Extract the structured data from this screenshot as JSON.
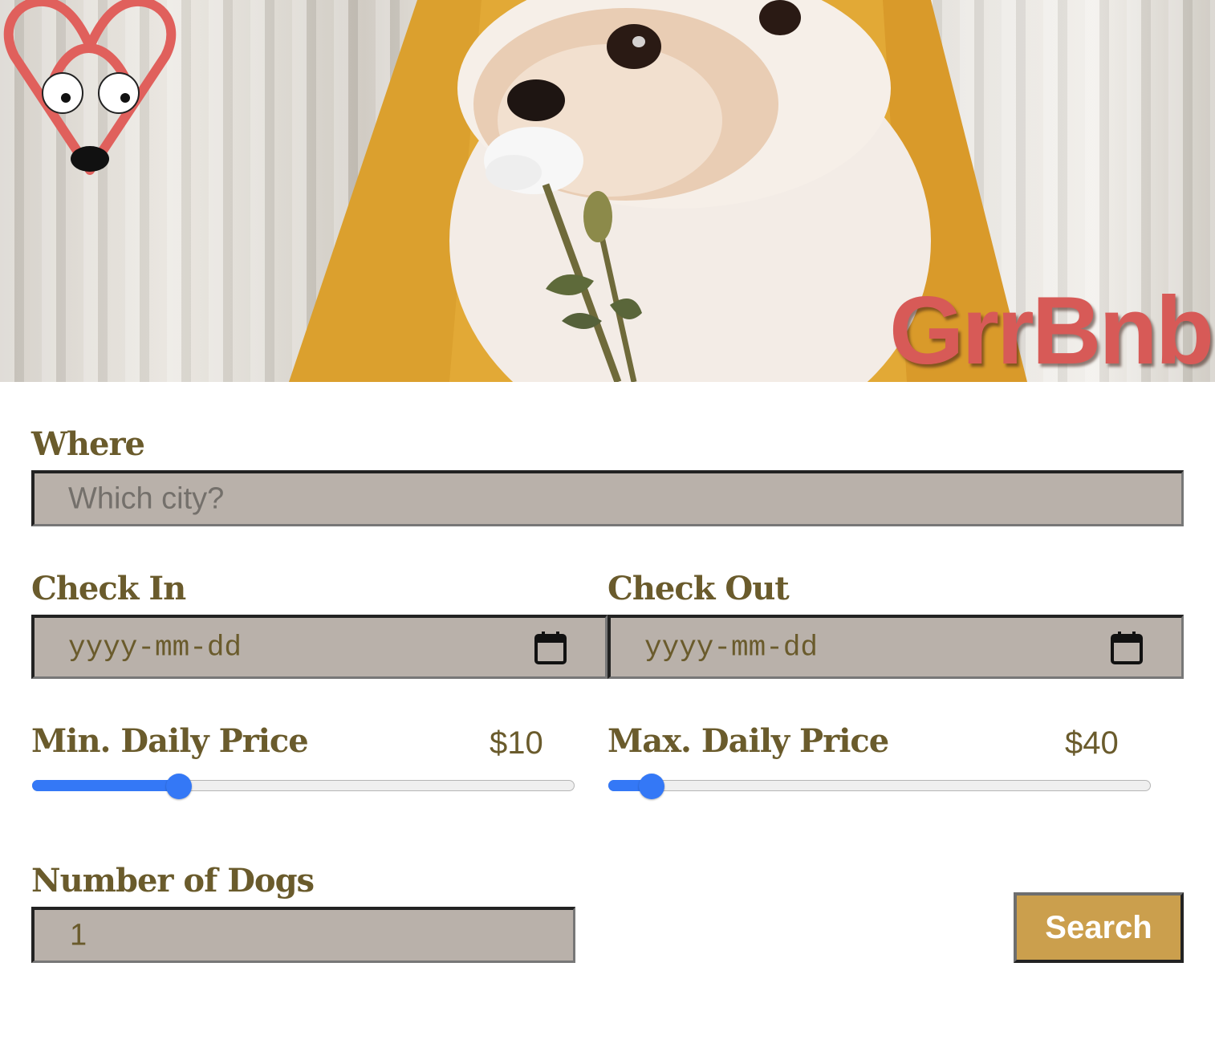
{
  "brand": {
    "name": "GrrBnb",
    "logo_icon": "dog-heart-logo-icon",
    "accent_color": "#d75a57"
  },
  "hero": {
    "image": "pomeranian-with-rose-photo"
  },
  "form": {
    "where": {
      "label": "Where",
      "placeholder": "Which city?",
      "value": ""
    },
    "check_in": {
      "label": "Check In",
      "placeholder": "yyyy-mm-dd",
      "icon": "calendar-icon"
    },
    "check_out": {
      "label": "Check Out",
      "placeholder": "yyyy-mm-dd",
      "icon": "calendar-icon"
    },
    "min_price": {
      "label": "Min. Daily Price",
      "display": "$10",
      "slider_fraction": 0.27
    },
    "max_price": {
      "label": "Max. Daily Price",
      "display": "$40",
      "slider_fraction": 0.08
    },
    "dogs": {
      "label": "Number of Dogs",
      "value": "1"
    },
    "search_button": "Search"
  },
  "colors": {
    "label_text": "#6a5b2c",
    "field_bg": "#b9b1aa",
    "slider_accent": "#3478f6",
    "button_bg": "#cb9f4d"
  }
}
